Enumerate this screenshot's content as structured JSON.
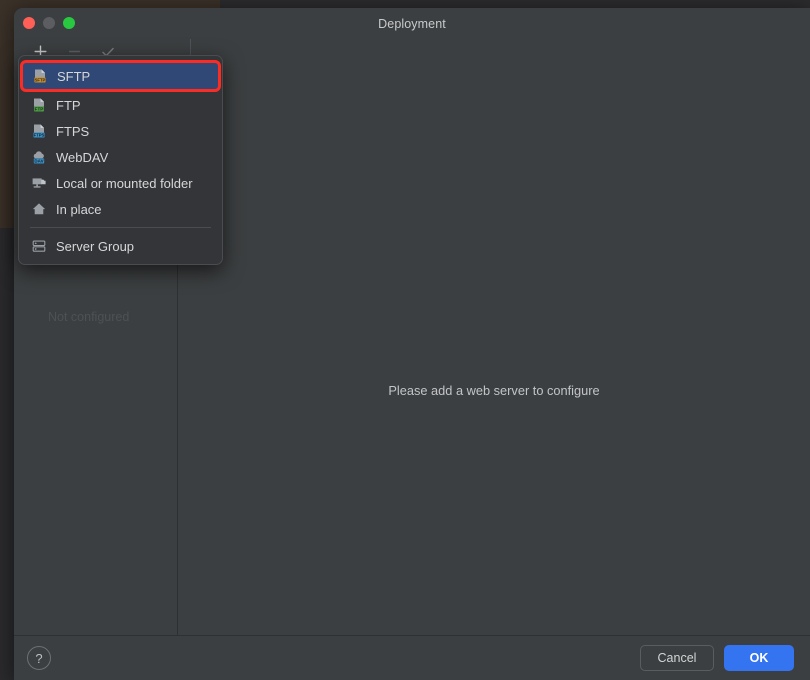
{
  "window": {
    "title": "Deployment",
    "traffic_lights": [
      {
        "name": "close",
        "color": "#ff5f57"
      },
      {
        "name": "minimize",
        "color": "#5b5d60"
      },
      {
        "name": "zoom",
        "color": "#28c840"
      }
    ]
  },
  "toolbar": {
    "buttons": [
      {
        "name": "add-server-button",
        "icon": "plus-icon",
        "glyph": "+",
        "enabled": true
      },
      {
        "name": "remove-server-button",
        "icon": "minus-icon",
        "glyph": "−",
        "enabled": false
      },
      {
        "name": "set-default-button",
        "icon": "check-icon",
        "glyph": "✓",
        "enabled": false
      }
    ]
  },
  "server_list": {
    "status_label": "Not configured"
  },
  "content": {
    "empty_message": "Please add a web server to configure"
  },
  "menu": {
    "items": [
      {
        "label": "SFTP",
        "icon": "sftp-file-icon",
        "selected": true,
        "badge": "SFTP",
        "badge_color": "#c9902a"
      },
      {
        "label": "FTP",
        "icon": "ftp-file-icon",
        "selected": false,
        "badge": "FTP",
        "badge_color": "#4f9c45"
      },
      {
        "label": "FTPS",
        "icon": "ftps-file-icon",
        "selected": false,
        "badge": "FTPS",
        "badge_color": "#3d8fc4"
      },
      {
        "label": "WebDAV",
        "icon": "webdav-cloud-icon",
        "selected": false,
        "badge": "DAV",
        "badge_color": "#3d8fc4"
      },
      {
        "label": "Local or mounted folder",
        "icon": "monitor-icon",
        "selected": false,
        "badge": "",
        "badge_color": ""
      },
      {
        "label": "In place",
        "icon": "home-icon",
        "selected": false,
        "badge": "",
        "badge_color": ""
      },
      {
        "label": "Server Group",
        "icon": "server-group-icon",
        "selected": false,
        "badge": "",
        "badge_color": ""
      }
    ],
    "separator_before_index": 6,
    "selection_highlight_color": "#fb2c24",
    "selection_background_color": "#2f4875"
  },
  "footer": {
    "help_glyph": "?",
    "cancel_label": "Cancel",
    "ok_label": "OK",
    "ok_color": "#3574f0"
  }
}
